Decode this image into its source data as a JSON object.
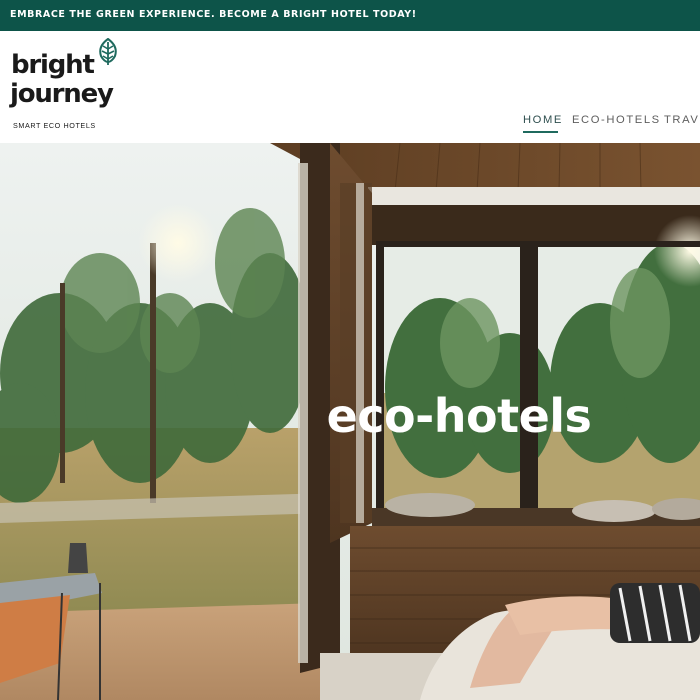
{
  "banner": {
    "text": "EMBRACE THE GREEN EXPERIENCE. BECOME A BRIGHT HOTEL TODAY!"
  },
  "logo": {
    "line1": "bright",
    "line2": "journey",
    "tagline": "SMART ECO HOTELS",
    "icon": "leaf-icon"
  },
  "nav": {
    "items": [
      {
        "label": "HOME",
        "active": true
      },
      {
        "label": "ECO-HOTELS",
        "active": false
      },
      {
        "label": "TRAVE",
        "active": false
      }
    ]
  },
  "hero": {
    "title": "eco-hotels",
    "image": "cabin-interior-with-forest-view-photo"
  },
  "colors": {
    "banner_bg": "#0d5449",
    "accent": "#1f6a5e",
    "nav_text": "#5e5e5e",
    "hero_title": "#ffffff"
  }
}
